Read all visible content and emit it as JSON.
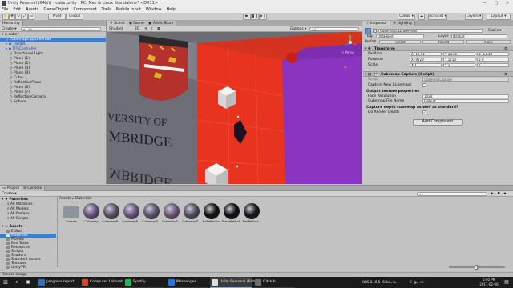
{
  "window": {
    "title": "Unity Personal (64bit) - cube.unity - PC, Mac & Linux Standalone* <DX11>",
    "controls": [
      "—",
      "□",
      "✕"
    ]
  },
  "menu": [
    "File",
    "Edit",
    "Assets",
    "GameObject",
    "Component",
    "Tools",
    "Mobile Input",
    "Window",
    "Help"
  ],
  "toolbar": {
    "pivot": "Pivot",
    "global": "Global",
    "collab": "Collab ▾",
    "account": "Account ▾",
    "layers": "Layers ▾",
    "layout": "Layout ▾"
  },
  "hierarchy": {
    "tab": "Hierarchy",
    "create": "Create ▾",
    "search_placeholder": "All",
    "scene": "cube*",
    "items": [
      {
        "label": "CubemapCaptureProbe",
        "indent": 1,
        "selected": true
      },
      {
        "label": "_Target",
        "indent": 1,
        "blue": true
      },
      {
        "label": "FPSController",
        "indent": 1,
        "blue": true
      },
      {
        "label": "Directional Light",
        "indent": 2
      },
      {
        "label": "Plane (1)",
        "indent": 2
      },
      {
        "label": "Plane (2)",
        "indent": 2
      },
      {
        "label": "Plane (3)",
        "indent": 2
      },
      {
        "label": "Plane (4)",
        "indent": 2
      },
      {
        "label": "Cube",
        "indent": 2
      },
      {
        "label": "ReflectionPlane",
        "indent": 2
      },
      {
        "label": "Plane (6)",
        "indent": 2
      },
      {
        "label": "Plane (7)",
        "indent": 2
      },
      {
        "label": "ReflectionCamera",
        "indent": 2
      },
      {
        "label": "Sphere",
        "indent": 2
      }
    ]
  },
  "scene": {
    "tabs": [
      "Scene",
      "Game",
      "Asset Store"
    ],
    "shaded": "Shaded",
    "mode_2d": "2D",
    "gizmos": "Gizmos ▾",
    "search_placeholder": "All",
    "banner_text_1": "VERSITY OF",
    "banner_text_2": "MBRIDGE",
    "banner_text_3": "MBRIDGE",
    "persp": "< Persp"
  },
  "inspector": {
    "tabs": [
      "Inspector",
      "Lighting"
    ],
    "object_name": "CubemapCaptureProbe",
    "static": "Static ▾",
    "tag_label": "Tag",
    "tag_value": "Untagged",
    "layer_label": "Layer",
    "layer_value": "Default",
    "prefab_label": "Prefab",
    "prefab_select": "Select",
    "prefab_revert": "Revert",
    "prefab_apply": "Apply",
    "transform": {
      "title": "Transform",
      "rows": [
        {
          "label": "Position",
          "x": "X -17.51",
          "y": "Y 10.21",
          "z": "Z -13.19"
        },
        {
          "label": "Rotation",
          "x": "X -9720",
          "y": "Y 1710",
          "z": "Z 0"
        },
        {
          "label": "Scale",
          "x": "X 1",
          "y": "Y 1",
          "z": "Z 1"
        }
      ]
    },
    "capture": {
      "title": "Cubemap Capture (Script)",
      "script_label": "Script",
      "script_value": "CubemapCapture",
      "capture_new_label": "Capture New Cubemaps",
      "output_header": "Output texture properties",
      "face_res_label": "Face Resolution",
      "face_res_value": "1024",
      "file_name_label": "Cubemap File Name",
      "file_name_value": "Default",
      "question": "Capture depth cubemap as well as standard?",
      "depth_label": "Do Render Depth",
      "depth_checked": "✓"
    },
    "add_component": "Add Component"
  },
  "project": {
    "tabs": [
      "Project",
      "Console"
    ],
    "create": "Create ▾",
    "breadcrumb": "Assets ▸ Materials",
    "favorites_title": "Favorites",
    "favorites": [
      "All Materials",
      "All Models",
      "All Prefabs",
      "All Scripts"
    ],
    "assets_title": "Assets",
    "folders": [
      {
        "label": "Editor",
        "indent": 1
      },
      {
        "label": "Materials",
        "indent": 1,
        "selected": true
      },
      {
        "label": "Models",
        "indent": 1
      },
      {
        "label": "Red Trace",
        "indent": 1
      },
      {
        "label": "Resources",
        "indent": 1
      },
      {
        "label": "Scripts",
        "indent": 1
      },
      {
        "label": "Shaders",
        "indent": 1
      },
      {
        "label": "Standard Assets",
        "indent": 1
      },
      {
        "label": "Textures",
        "indent": 1
      },
      {
        "label": "UnityVR",
        "indent": 1
      }
    ],
    "assets": [
      {
        "label": "Frames",
        "color": "#8c959c",
        "shape": "folder"
      },
      {
        "label": "Cubemap",
        "color": "#6a4f7e"
      },
      {
        "label": "CubemapB...",
        "color": "#5a4f66"
      },
      {
        "label": "CubemapB...",
        "color": "#6b5478"
      },
      {
        "label": "CubemapD...",
        "color": "#5d5168"
      },
      {
        "label": "CubemapD...",
        "color": "#6a5675"
      },
      {
        "label": "CubemapD...",
        "color": "#534a5c"
      },
      {
        "label": "NoReflection",
        "color": "#111111"
      },
      {
        "label": "PlaneReflect...",
        "color": "#0e0e0e"
      },
      {
        "label": "TestReflect...",
        "color": "#151515"
      }
    ],
    "status": "Render image"
  },
  "taskbar": {
    "items": [
      {
        "label": "progress report",
        "color": "#2f6fc0"
      },
      {
        "label": "Computer Laborat...",
        "color": "#d04a2a"
      },
      {
        "label": "Spotify",
        "color": "#1db954"
      },
      {
        "label": "Messenger",
        "color": "#1877f2"
      },
      {
        "label": "Unity Personal (64b...",
        "color": "#dddddd",
        "active": true
      },
      {
        "label": "GitHub",
        "color": "#6e6e6e"
      }
    ],
    "tray_text": "OBS 0.16.5 (64bit, w...",
    "time": "6:40 PM",
    "date": "2017-02-06"
  },
  "colors": {
    "selection": "#3e7ed1",
    "scene_red": "#e8341f",
    "scene_purple": "#8a34c2",
    "scene_wall": "#6a6a72",
    "crest": "#b4322b"
  }
}
